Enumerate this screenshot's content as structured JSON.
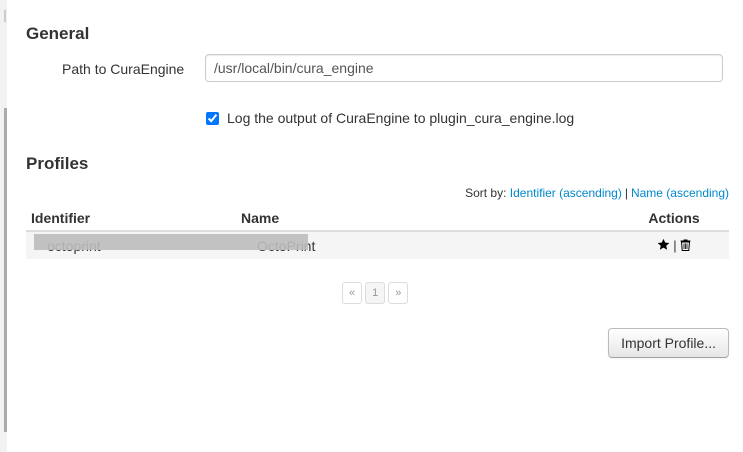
{
  "general": {
    "heading": "General",
    "path_label": "Path to CuraEngine",
    "path_value": "/usr/local/bin/cura_engine",
    "log_checked": true,
    "log_label": "Log the output of CuraEngine to plugin_cura_engine.log"
  },
  "profiles": {
    "heading": "Profiles",
    "sort_label": "Sort by:",
    "sort_identifier": "Identifier (ascending)",
    "sort_separator": "|",
    "sort_name": "Name (ascending)",
    "columns": {
      "identifier": "Identifier",
      "name": "Name",
      "actions": "Actions"
    },
    "rows": [
      {
        "identifier": "octoprint",
        "name": "OctoPrint",
        "actions": [
          "star-icon",
          "trash-icon"
        ],
        "action_separator": "|"
      }
    ],
    "pagination": {
      "prev": "«",
      "pages": [
        "1"
      ],
      "next": "»",
      "current": "1"
    },
    "import_button": "Import Profile..."
  }
}
